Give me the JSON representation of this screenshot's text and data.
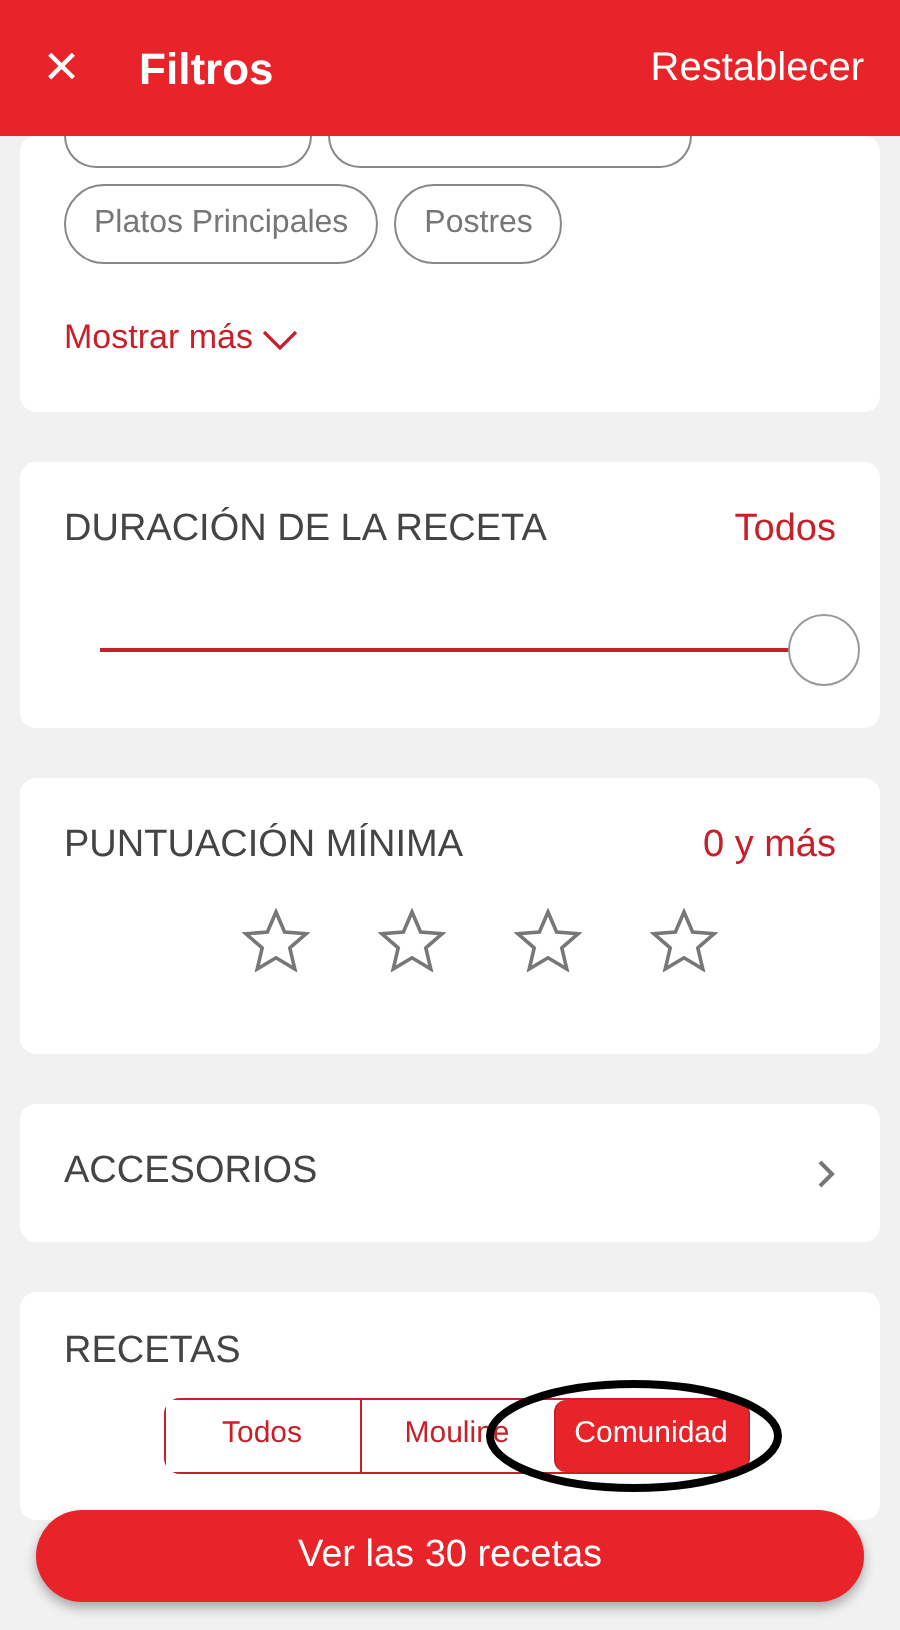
{
  "header": {
    "close": "×",
    "title": "Filtros",
    "action": "Restablecer"
  },
  "categories": {
    "chips": [
      {
        "label": "Platos Principales",
        "selected": false
      },
      {
        "label": "Postres",
        "selected": false
      }
    ],
    "more_link": "Mostrar más"
  },
  "duration": {
    "title": "DURACIÓN DE LA RECETA",
    "value": "Todos",
    "level": 1.0
  },
  "rating": {
    "title": "PUNTUACIÓN MÍNIMA",
    "value": "0 y más",
    "stars": 0
  },
  "accessories": {
    "title": "ACCESORIOS"
  },
  "recipes": {
    "title": "RECETAS",
    "options": [
      {
        "label": "Todos",
        "selected": false,
        "circled": false
      },
      {
        "label": "Mouline",
        "selected": false,
        "circled": false
      },
      {
        "label": "Comunidad",
        "selected": true,
        "circled": true
      }
    ]
  },
  "submit": "Ver las 30 recetas"
}
